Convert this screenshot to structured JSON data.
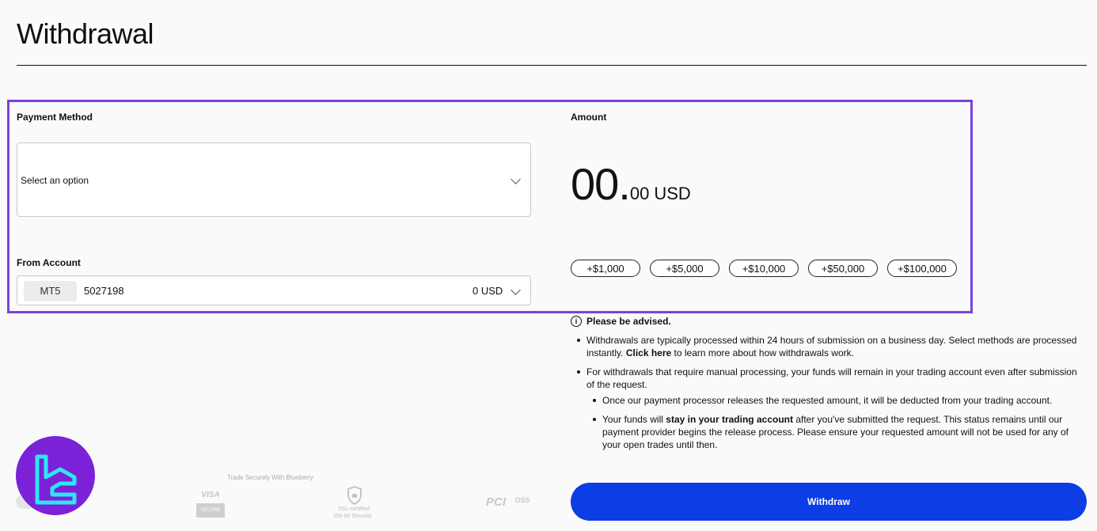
{
  "page": {
    "title": "Withdrawal"
  },
  "payment_method": {
    "label": "Payment Method",
    "placeholder": "Select an option"
  },
  "from_account": {
    "label": "From Account",
    "platform": "MT5",
    "account_number": "5027198",
    "balance": "0 USD"
  },
  "amount": {
    "label": "Amount",
    "integer": "00.",
    "decimal": "00",
    "currency": "USD",
    "quick_amounts": [
      "+$1,000",
      "+$5,000",
      "+$10,000",
      "+$50,000",
      "+$100,000"
    ]
  },
  "advisory": {
    "title": "Please be advised.",
    "b1_a": "Withdrawals are typically processed within 24 hours of submission on a business day. Select methods are processed",
    "b1_b_pre": "instantly.",
    "b1_link": "Click here",
    "b1_b_post": "to learn more about how withdrawals work.",
    "b2_a": "For withdrawals that require manual processing, your funds will remain in your trading account even after submission",
    "b2_b": "of the request.",
    "s1": "Once our payment processor releases the requested amount, it will be deducted from your trading account.",
    "s2_pre": "Your funds will",
    "s2_bold": "stay in your trading account",
    "s2_post": "after you've submitted the request. This status remains until our",
    "s2_b": "payment provider begins the release process. Please ensure your requested amount will not be used for any of",
    "s2_c": "your open trades until then."
  },
  "withdraw_button": "Withdraw",
  "footer": {
    "secure_text": "Trade Securely With Blueberry",
    "visa": "VISA",
    "visa_sub": "SECURE",
    "ssl_a": "SSL-certified",
    "ssl_b": "256-bit Security",
    "pci": "PCI",
    "dss": "DSS"
  },
  "colors": {
    "accent": "#0d3de5",
    "highlight": "#7b3fe4",
    "logo_bg": "#7b22d9",
    "logo_mark": "#2ee6f5"
  },
  "icons": [
    "chevron-down-icon",
    "info-icon",
    "shield-icon",
    "watermark-logo"
  ]
}
